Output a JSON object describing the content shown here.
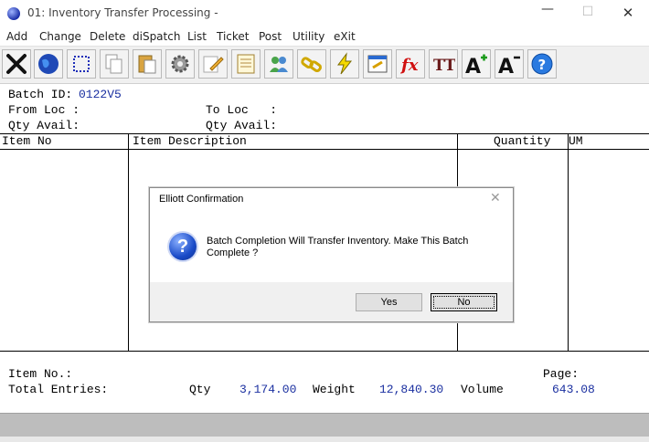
{
  "window": {
    "title": "01: Inventory Transfer Processing -",
    "min_glyph": "—",
    "max_glyph": "☐",
    "close_glyph": "✕"
  },
  "menu": [
    "Add",
    "Change",
    "Delete",
    "diSpatch",
    "List",
    "Ticket",
    "Post",
    "Utility",
    "eXit"
  ],
  "toolbar": {
    "icons": [
      "delete-icon",
      "globe-icon",
      "select-icon",
      "copy-icon",
      "paste-icon",
      "settings-icon",
      "edit-icon",
      "notes-icon",
      "users-icon",
      "link-icon",
      "lightning-icon",
      "export-icon",
      "formula-icon",
      "font-size-icon",
      "font-increase-icon",
      "font-decrease-icon",
      "help-icon"
    ],
    "formula_text": "fx",
    "font_text": "TT",
    "font_up_text": "A",
    "font_down_text": "A",
    "help_text": "?"
  },
  "form": {
    "batch_label": "Batch ID:",
    "batch_value": "0122V5",
    "from_loc_label": "From Loc :",
    "to_loc_label": "To Loc   :",
    "qty_avail_left": "Qty Avail:",
    "qty_avail_right": "Qty Avail:"
  },
  "grid": {
    "columns": [
      "Item No",
      "Item Description",
      "Quantity",
      "UM"
    ]
  },
  "footer": {
    "item_no_label": "Item No.:",
    "page_label": "Page:",
    "total_entries_label": "Total Entries:",
    "qty_label": "Qty",
    "qty_value": "3,174.00",
    "weight_label": "Weight",
    "weight_value": "12,840.30",
    "volume_label": "Volume",
    "volume_value": "643.08"
  },
  "dialog": {
    "title": "Elliott Confirmation",
    "close_glyph": "✕",
    "icon": "question-icon",
    "icon_glyph": "?",
    "message": "Batch Completion Will Transfer Inventory.  Make This Batch Complete ?",
    "yes_label": "Yes",
    "no_label": "No"
  }
}
